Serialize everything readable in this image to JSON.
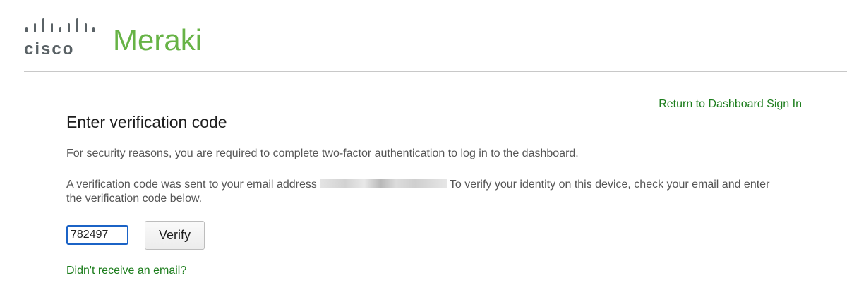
{
  "header": {
    "brand": "cisco",
    "product": "Meraki",
    "brand_color": "#67b346"
  },
  "return_link": "Return to Dashboard Sign In",
  "title": "Enter verification code",
  "paragraph1": "For security reasons, you are required to complete two-factor authentication to log in to the dashboard.",
  "paragraph2": {
    "before": "A verification code was sent to your email address",
    "after": "To verify your identity on this device, check your email and enter the verification code below."
  },
  "code_input": {
    "value": "782497"
  },
  "verify_label": "Verify",
  "no_email_link": "Didn't receive an email?",
  "colors": {
    "link": "#1c7d1c",
    "input_focus": "#1b63c6",
    "text": "#555555"
  }
}
